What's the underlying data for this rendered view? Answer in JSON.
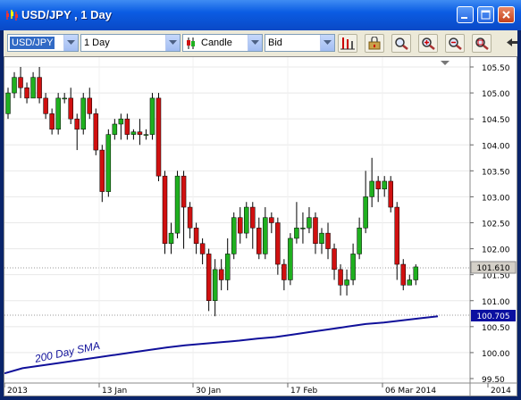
{
  "window": {
    "title": "USD/JPY , 1 Day",
    "minimize_icon": "minimize-icon",
    "maximize_icon": "maximize-icon",
    "close_icon": "close-icon"
  },
  "toolbar": {
    "instrument": "USD/JPY",
    "period": "1 Day",
    "chart_type": "Candle",
    "price_side": "Bid",
    "tools": [
      "bar-chart-icon",
      "lock-icon",
      "zoom-icon",
      "zoom-in-icon",
      "zoom-out-icon",
      "zoom-fit-icon"
    ]
  },
  "colors": {
    "bull": "#1fb01f",
    "bear": "#d01010",
    "sma": "#10109a",
    "price_tag": "#d4d0c8",
    "sma_tag": "#0a10a0"
  },
  "chart_data": {
    "type": "candlestick",
    "price_axis": {
      "ticks": [
        "105.50",
        "105.00",
        "104.50",
        "104.00",
        "103.50",
        "103.00",
        "102.50",
        "102.00",
        "101.50",
        "101.00",
        "100.50",
        "100.00",
        "99.50"
      ],
      "min": 99.5,
      "max": 105.5
    },
    "date_axis": {
      "labels": [
        "2013",
        "13 Jan",
        "30 Jan",
        "17 Feb",
        "06 Mar 2014",
        "2014"
      ]
    },
    "current_price_label": "101.610",
    "sma_value_label": "100.705",
    "sma_name": "200 Day SMA",
    "candles": [
      [
        104.6,
        105.0,
        105.1,
        104.5
      ],
      [
        105.0,
        105.3,
        105.4,
        104.9
      ],
      [
        105.3,
        105.1,
        105.5,
        104.9
      ],
      [
        105.1,
        104.9,
        105.2,
        104.8
      ],
      [
        104.9,
        105.3,
        105.4,
        104.9
      ],
      [
        105.3,
        104.9,
        105.5,
        104.8
      ],
      [
        104.9,
        104.6,
        105.0,
        104.5
      ],
      [
        104.6,
        104.3,
        104.7,
        104.2
      ],
      [
        104.3,
        104.9,
        105.0,
        104.2
      ],
      [
        104.9,
        104.9,
        105.0,
        104.8
      ],
      [
        104.9,
        104.5,
        105.1,
        104.4
      ],
      [
        104.5,
        104.3,
        104.6,
        103.9
      ],
      [
        104.3,
        104.9,
        105.0,
        104.2
      ],
      [
        104.9,
        104.6,
        105.1,
        104.5
      ],
      [
        104.6,
        103.9,
        104.7,
        103.8
      ],
      [
        103.9,
        103.1,
        104.0,
        102.9
      ],
      [
        103.1,
        104.2,
        104.3,
        103.0
      ],
      [
        104.2,
        104.4,
        104.5,
        104.1
      ],
      [
        104.4,
        104.5,
        104.6,
        104.1
      ],
      [
        104.5,
        104.2,
        104.6,
        104.1
      ],
      [
        104.2,
        104.25,
        104.3,
        104.1
      ],
      [
        104.25,
        104.2,
        104.5,
        104.0
      ],
      [
        104.2,
        104.2,
        104.3,
        104.1
      ],
      [
        104.2,
        104.9,
        105.0,
        104.1
      ],
      [
        104.9,
        103.4,
        105.0,
        103.3
      ],
      [
        103.4,
        102.1,
        103.5,
        101.9
      ],
      [
        102.1,
        102.3,
        102.5,
        101.9
      ],
      [
        102.3,
        103.4,
        103.5,
        102.2
      ],
      [
        103.4,
        102.8,
        103.5,
        102.0
      ],
      [
        102.8,
        102.4,
        102.9,
        102.2
      ],
      [
        102.4,
        102.1,
        102.5,
        101.9
      ],
      [
        102.1,
        101.9,
        102.2,
        101.7
      ],
      [
        101.9,
        101.0,
        102.0,
        100.8
      ],
      [
        101.0,
        101.6,
        101.8,
        100.7
      ],
      [
        101.6,
        101.4,
        101.8,
        101.2
      ],
      [
        101.4,
        101.9,
        102.2,
        101.2
      ],
      [
        101.9,
        102.6,
        102.7,
        101.8
      ],
      [
        102.6,
        102.3,
        102.8,
        102.1
      ],
      [
        102.3,
        102.8,
        102.9,
        102.2
      ],
      [
        102.8,
        102.4,
        102.9,
        102.0
      ],
      [
        102.4,
        101.9,
        102.6,
        101.8
      ],
      [
        101.9,
        102.6,
        102.8,
        101.8
      ],
      [
        102.6,
        102.5,
        102.7,
        102.3
      ],
      [
        102.5,
        101.7,
        102.6,
        101.5
      ],
      [
        101.7,
        101.4,
        101.8,
        101.2
      ],
      [
        101.4,
        102.2,
        102.3,
        101.3
      ],
      [
        102.2,
        102.4,
        102.9,
        102.1
      ],
      [
        102.4,
        102.4,
        102.7,
        102.1
      ],
      [
        102.4,
        102.6,
        102.8,
        102.3
      ],
      [
        102.6,
        102.1,
        102.7,
        101.9
      ],
      [
        102.1,
        102.3,
        102.4,
        101.9
      ],
      [
        102.3,
        102.0,
        102.5,
        101.8
      ],
      [
        102.0,
        101.6,
        102.1,
        101.4
      ],
      [
        101.6,
        101.3,
        101.7,
        101.1
      ],
      [
        101.3,
        101.4,
        101.6,
        101.1
      ],
      [
        101.4,
        101.9,
        102.1,
        101.3
      ],
      [
        101.9,
        102.4,
        102.6,
        101.8
      ],
      [
        102.4,
        103.0,
        103.5,
        102.3
      ],
      [
        103.0,
        103.3,
        103.75,
        102.8
      ],
      [
        103.3,
        103.15,
        103.4,
        102.9
      ],
      [
        103.15,
        103.3,
        103.4,
        103.0
      ],
      [
        103.3,
        102.8,
        103.4,
        102.7
      ],
      [
        102.8,
        101.7,
        102.9,
        101.4
      ],
      [
        101.7,
        101.3,
        101.8,
        101.2
      ],
      [
        101.3,
        101.4,
        101.5,
        101.3
      ],
      [
        101.4,
        101.65,
        101.7,
        101.3
      ]
    ],
    "sma": [
      99.6,
      99.7,
      99.75,
      99.8,
      99.85,
      99.9,
      99.95,
      100.0,
      100.05,
      100.1,
      100.14,
      100.17,
      100.2,
      100.23,
      100.27,
      100.3,
      100.35,
      100.4,
      100.45,
      100.5,
      100.55,
      100.58,
      100.62,
      100.66,
      100.7
    ]
  }
}
